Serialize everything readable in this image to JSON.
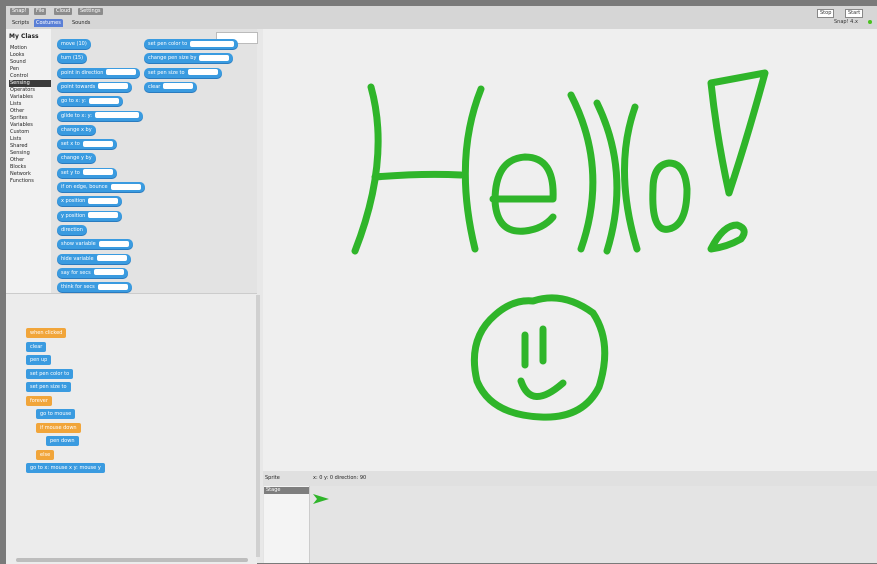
{
  "topbar": {
    "menus": [
      "Snap!",
      "File",
      "Cloud",
      "Settings"
    ],
    "tabs": [
      "Scripts",
      "Costumes",
      "Sounds"
    ],
    "selected_tab": "Scripts",
    "stage_buttons": [
      "Stop",
      "Start"
    ],
    "status": "Snap! 4.x"
  },
  "categories": {
    "header": "My Class",
    "items": [
      "Motion",
      "Looks",
      "Sound",
      "Pen",
      "Control",
      "Sensing",
      "Operators",
      "Variables",
      "Lists",
      "Other",
      "Sprites",
      "Variables",
      "Custom",
      "Lists",
      "Shared",
      "Sensing",
      "Other",
      "Blocks",
      "Network",
      "Functions"
    ],
    "selected_index": 5
  },
  "palette": {
    "left_blocks": [
      "move (10)",
      "turn (15)",
      "point in direction",
      "point towards",
      "go to x: y:",
      "glide to x: y:",
      "change x by",
      "set x to",
      "change y by",
      "set y to",
      "if on edge, bounce",
      "x position",
      "y position",
      "direction",
      "show variable",
      "hide variable",
      "say for secs",
      "think for secs"
    ],
    "right_blocks": [
      "set pen color to",
      "change pen size by",
      "set pen size to",
      "clear"
    ]
  },
  "scripts": {
    "blocks": [
      {
        "label": "when clicked",
        "color": "orange"
      },
      {
        "label": "clear",
        "color": "blue"
      },
      {
        "label": "pen up",
        "color": "blue"
      },
      {
        "label": "set pen color to",
        "color": "blue"
      },
      {
        "label": "set pen size to",
        "color": "blue"
      },
      {
        "label": "forever",
        "color": "orange"
      },
      {
        "label": "go to mouse",
        "color": "blue"
      },
      {
        "label": "if mouse down",
        "color": "orange"
      },
      {
        "label": "pen down",
        "color": "blue"
      },
      {
        "label": "else",
        "color": "orange"
      },
      {
        "label": "go to x: mouse x y: mouse y",
        "color": "blue"
      }
    ]
  },
  "stage": {
    "text": "Hello!",
    "ink_color": "#2fb52a",
    "bar_label": "Sprite",
    "bar_info": "x: 0 y: 0 direction: 90",
    "stage_thumb_label": "Stage"
  }
}
